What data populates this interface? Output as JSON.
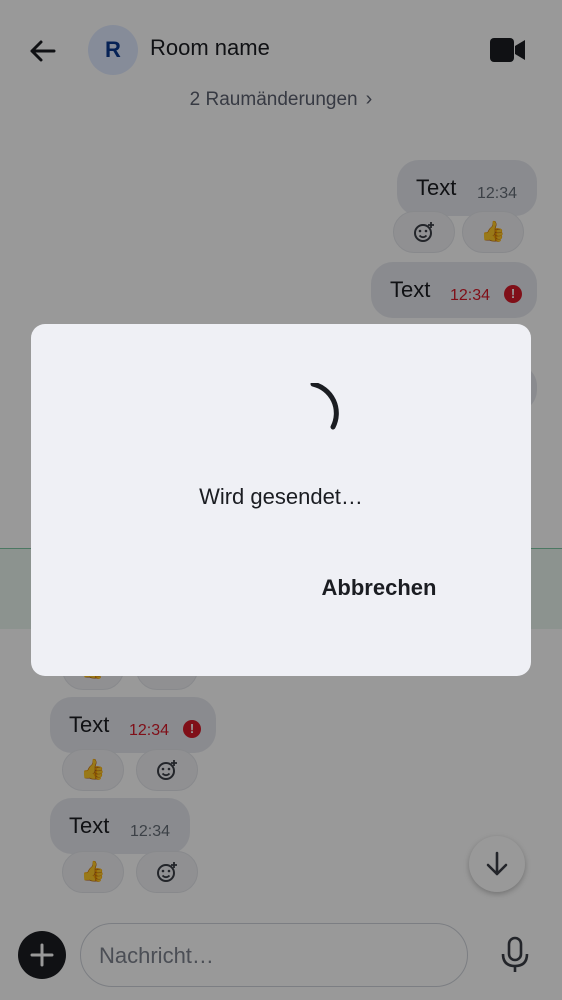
{
  "header": {
    "avatar_letter": "R",
    "room_name": "Room name"
  },
  "timeline": {
    "room_changes": "2 Raumänderungen",
    "messages": [
      {
        "text": "Text",
        "time": "12:34",
        "reaction": "👍"
      },
      {
        "text": "Text",
        "time": "12:34"
      },
      {
        "text": "Text",
        "time": "12:34",
        "reaction": "👍"
      },
      {
        "text": "Text",
        "time": "12:34",
        "reaction": "👍"
      }
    ]
  },
  "composer": {
    "placeholder": "Nachricht…"
  },
  "dialog": {
    "message": "Wird gesendet…",
    "cancel_label": "Abbrechen"
  },
  "colors": {
    "error": "#d51928",
    "scrim": "rgba(0,0,0,0.40)",
    "dialog_bg": "#eff0f5"
  }
}
